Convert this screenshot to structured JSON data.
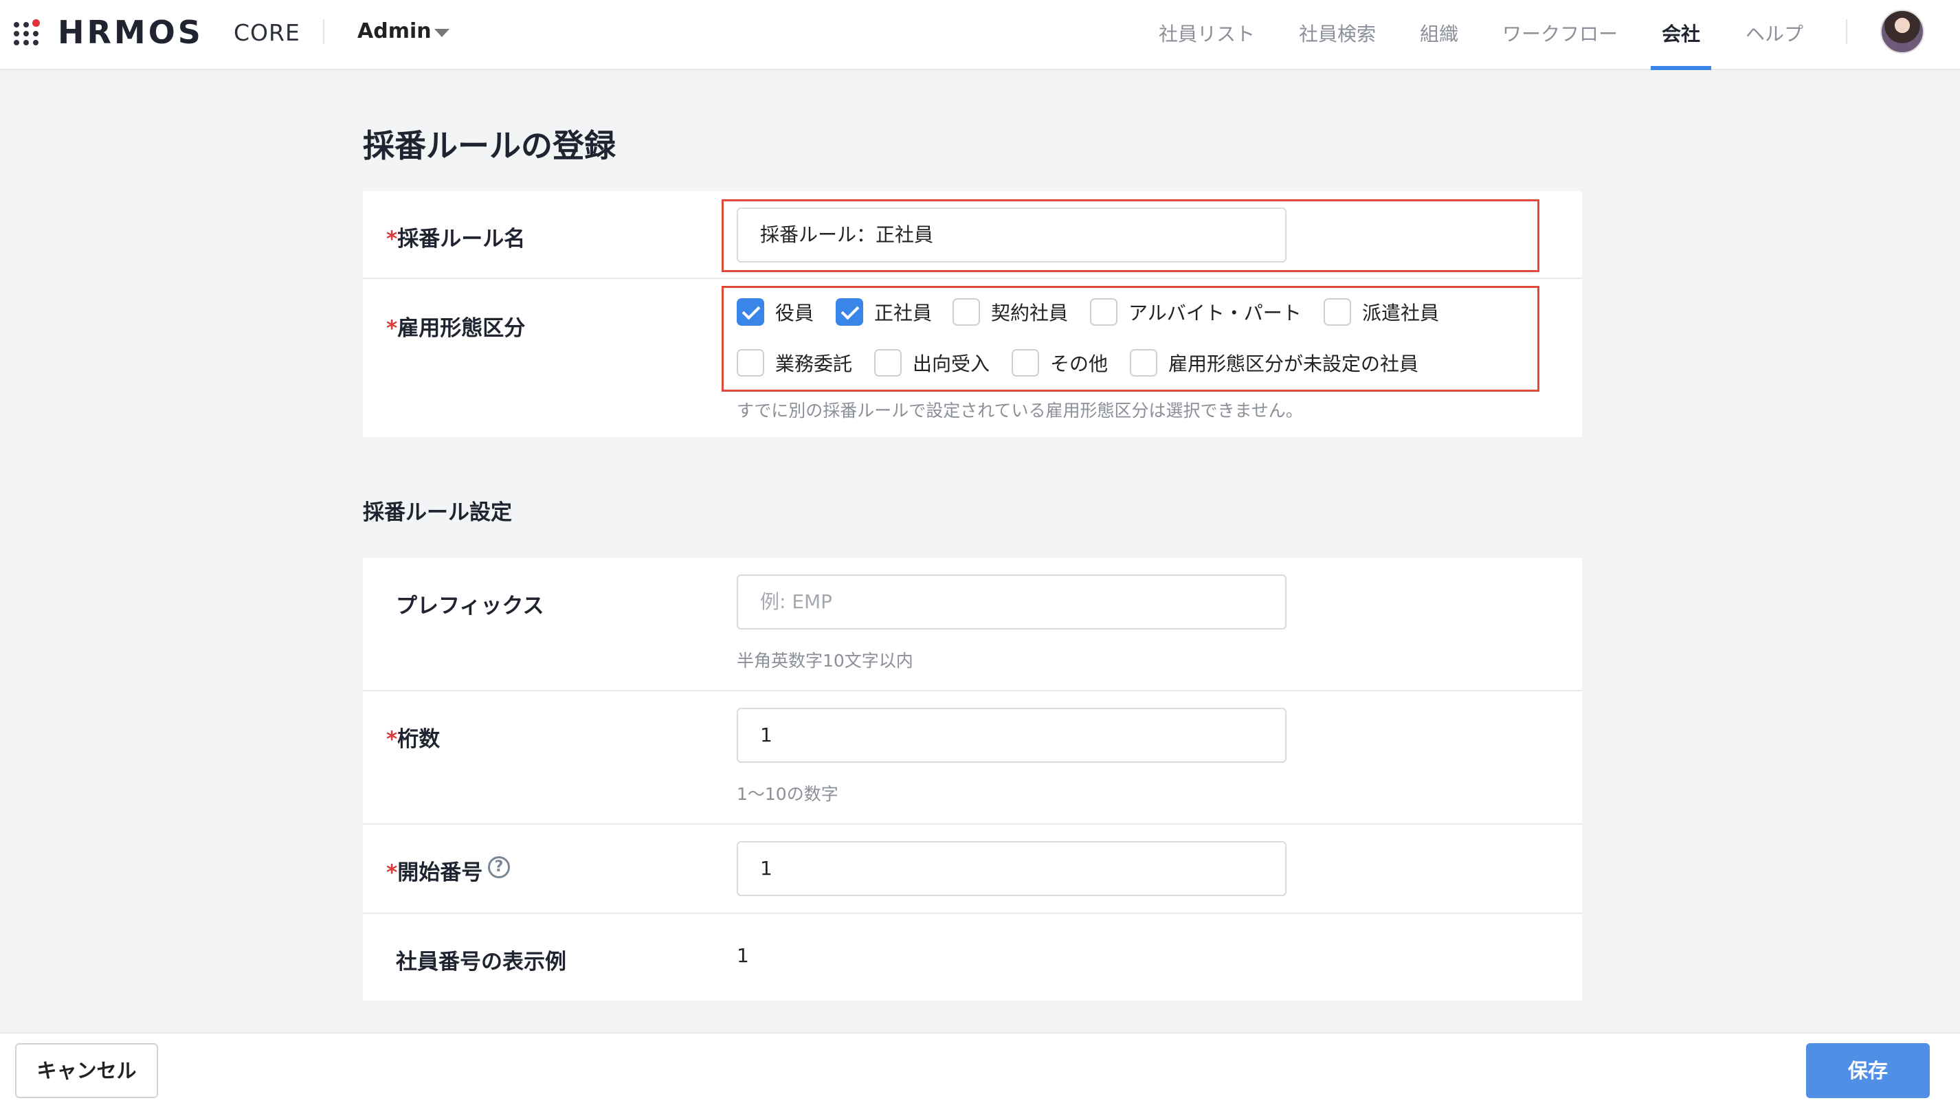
{
  "header": {
    "logo": "HRMOS",
    "logo_sub": "CORE",
    "role": "Admin",
    "nav": [
      "社員リスト",
      "社員検索",
      "組織",
      "ワークフロー",
      "会社",
      "ヘルプ"
    ],
    "active_nav": "会社",
    "accent_color": "#3a86e8"
  },
  "page_title": "採番ルールの登録",
  "rule_form": {
    "required_mark": "*",
    "name_label": "採番ルール名",
    "name_value": "採番ルール：正社員",
    "employment_label": "雇用形態区分",
    "employment_options": [
      {
        "label": "役員",
        "checked": true
      },
      {
        "label": "正社員",
        "checked": true
      },
      {
        "label": "契約社員",
        "checked": false
      },
      {
        "label": "アルバイト・パート",
        "checked": false
      },
      {
        "label": "派遣社員",
        "checked": false
      },
      {
        "label": "業務委託",
        "checked": false
      },
      {
        "label": "出向受入",
        "checked": false
      },
      {
        "label": "その他",
        "checked": false
      },
      {
        "label": "雇用形態区分が未設定の社員",
        "checked": false
      }
    ],
    "employment_hint": "すでに別の採番ルールで設定されている雇用形態区分は選択できません。"
  },
  "settings": {
    "section_title": "採番ルール設定",
    "prefix_label": "プレフィックス",
    "prefix_placeholder": "例: EMP",
    "prefix_hint": "半角英数字10文字以内",
    "digits_label": "桁数",
    "digits_value": "1",
    "digits_hint": "1〜10の数字",
    "start_label": "開始番号",
    "start_value": "1",
    "help_icon": "?",
    "example_label": "社員番号の表示例",
    "example_value": "1"
  },
  "footer": {
    "cancel_label": "キャンセル",
    "save_label": "保存",
    "save_color": "#4f8fe6"
  }
}
